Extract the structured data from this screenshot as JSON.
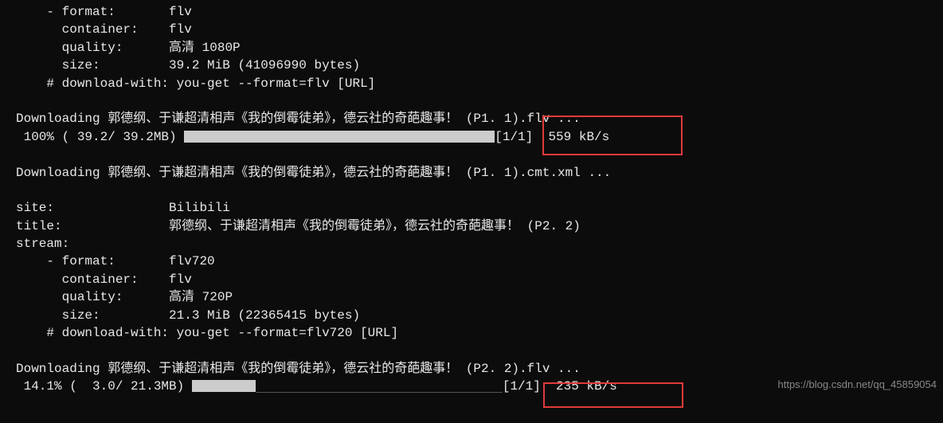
{
  "block1": {
    "l1": "    - format:       flv",
    "l2": "      container:    flv",
    "l3": "      quality:      高清 1080P",
    "l4": "      size:         39.2 MiB (41096990 bytes)",
    "l5": "    # download-with: you-get --format=flv [URL]"
  },
  "dl1": {
    "pre": "Downloading 郭德纲、于谦超清相声《我的倒霉徒弟》，德云社的奇葩趣事！ (P1. 1).flv ...",
    "prog_left": " 100% ( 39.2/ 39.2MB) ",
    "prog_right": "[1/1]  559 kB/s"
  },
  "dl1b": "Downloading 郭德纲、于谦超清相声《我的倒霉徒弟》，德云社的奇葩趣事！ (P1. 1).cmt.xml ...",
  "info2": {
    "site": "site:               Bilibili",
    "title": "title:              郭德纲、于谦超清相声《我的倒霉徒弟》，德云社的奇葩趣事！ (P2. 2)",
    "stream": "stream:",
    "l1": "    - format:       flv720",
    "l2": "      container:    flv",
    "l3": "      quality:      高清 720P",
    "l4": "      size:         21.3 MiB (22365415 bytes)",
    "l5": "    # download-with: you-get --format=flv720 [URL]"
  },
  "dl2": {
    "pre": "Downloading 郭德纲、于谦超清相声《我的倒霉徒弟》，德云社的奇葩趣事！ (P2. 2).flv ...",
    "prog_left": " 14.1% (  3.0/ 21.3MB) ",
    "prog_right": "[1/1]  235 kB/s"
  },
  "watermark": "https://blog.csdn.net/qq_45859054"
}
